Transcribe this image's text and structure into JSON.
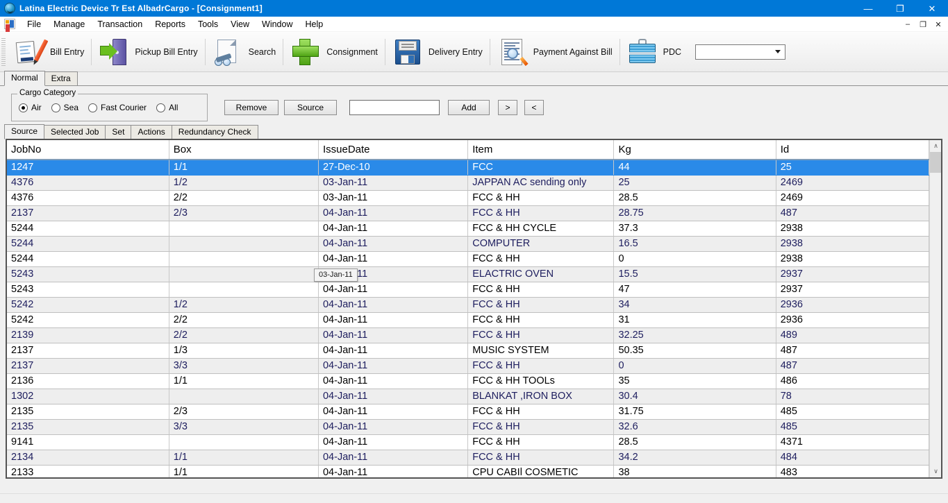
{
  "window": {
    "title": "Latina Electric Device Tr Est   AlbadrCargo - [Consignment1]",
    "app_icon": "app-globe-icon",
    "controls": {
      "minimize": "—",
      "maximize": "❐",
      "close": "✕"
    },
    "mdi_controls": {
      "minimize": "–",
      "restore": "❐",
      "close": "✕"
    },
    "accent": "#0078d7"
  },
  "menu": {
    "items": [
      "File",
      "Manage",
      "Transaction",
      "Reports",
      "Tools",
      "View",
      "Window",
      "Help"
    ]
  },
  "toolbar": {
    "items": [
      {
        "label": "Bill Entry",
        "icon": "bill-entry-icon"
      },
      {
        "label": "Pickup Bill Entry",
        "icon": "pickup-bill-entry-icon"
      },
      {
        "label": "Search",
        "icon": "search-icon"
      },
      {
        "label": "Consignment",
        "icon": "consignment-plus-icon"
      },
      {
        "label": "Delivery Entry",
        "icon": "delivery-entry-floppy-icon"
      },
      {
        "label": "Payment Against Bill",
        "icon": "payment-against-bill-icon"
      },
      {
        "label": "PDC",
        "icon": "pdc-briefcase-icon"
      }
    ],
    "pdc_combo": {
      "value": "",
      "caret": "chevron-down-icon"
    }
  },
  "tabs_top": {
    "items": [
      {
        "label": "Normal",
        "active": true
      },
      {
        "label": "Extra",
        "active": false
      }
    ]
  },
  "cargo_category": {
    "legend": "Cargo Category",
    "options": [
      {
        "label": "Air",
        "selected": true
      },
      {
        "label": "Sea",
        "selected": false
      },
      {
        "label": "Fast Courier",
        "selected": false
      },
      {
        "label": "All",
        "selected": false
      }
    ]
  },
  "actions": {
    "remove": "Remove",
    "source": "Source",
    "add": "Add",
    "next": ">",
    "prev": "<",
    "add_input": {
      "value": "",
      "placeholder": ""
    }
  },
  "tabs_sub": {
    "items": [
      {
        "label": "Source",
        "active": true
      },
      {
        "label": "Selected Job",
        "active": false
      },
      {
        "label": "Set",
        "active": false
      },
      {
        "label": "Actions",
        "active": false
      },
      {
        "label": "Redundancy Check",
        "active": false
      }
    ]
  },
  "tooltip": {
    "text": "03-Jan-11"
  },
  "grid": {
    "columns": [
      "JobNo",
      "Box",
      "IssueDate",
      "Item",
      "Kg",
      "Id"
    ],
    "selected_index": 0,
    "rows": [
      [
        "1247",
        "1/1",
        "27-Dec-10",
        "FCC",
        "44",
        "25"
      ],
      [
        "4376",
        "1/2",
        "03-Jan-11",
        "JAPPAN AC sending only",
        "25",
        "2469"
      ],
      [
        "4376",
        "2/2",
        "03-Jan-11",
        "FCC & HH",
        "28.5",
        "2469"
      ],
      [
        "2137",
        "2/3",
        "04-Jan-11",
        "FCC & HH",
        "28.75",
        "487"
      ],
      [
        "5244",
        "",
        "04-Jan-11",
        "FCC & HH CYCLE",
        "37.3",
        "2938"
      ],
      [
        "5244",
        "",
        "04-Jan-11",
        "COMPUTER",
        "16.5",
        "2938"
      ],
      [
        "5244",
        "",
        "04-Jan-11",
        "FCC & HH",
        "0",
        "2938"
      ],
      [
        "5243",
        "",
        "04-Jan-11",
        "ELACTRIC  OVEN",
        "15.5",
        "2937"
      ],
      [
        "5243",
        "",
        "04-Jan-11",
        "FCC & HH",
        "47",
        "2937"
      ],
      [
        "5242",
        "1/2",
        "04-Jan-11",
        "FCC & HH",
        "34",
        "2936"
      ],
      [
        "5242",
        "2/2",
        "04-Jan-11",
        "FCC & HH",
        "31",
        "2936"
      ],
      [
        "2139",
        "2/2",
        "04-Jan-11",
        "FCC & HH",
        "32.25",
        "489"
      ],
      [
        "2137",
        "1/3",
        "04-Jan-11",
        "MUSIC   SYSTEM",
        "50.35",
        "487"
      ],
      [
        "2137",
        "3/3",
        "04-Jan-11",
        "FCC & HH",
        "0",
        "487"
      ],
      [
        "2136",
        "1/1",
        "04-Jan-11",
        "FCC & HH TOOLs",
        "35",
        "486"
      ],
      [
        "1302",
        "",
        "04-Jan-11",
        "BLANKAT ,IRON BOX",
        "30.4",
        "78"
      ],
      [
        "2135",
        "2/3",
        "04-Jan-11",
        "FCC & HH",
        "31.75",
        "485"
      ],
      [
        "2135",
        "3/3",
        "04-Jan-11",
        "FCC & HH",
        "32.6",
        "485"
      ],
      [
        "9141",
        "",
        "04-Jan-11",
        "FCC & HH",
        "28.5",
        "4371"
      ],
      [
        "2134",
        "1/1",
        "04-Jan-11",
        "FCC & HH",
        "34.2",
        "484"
      ],
      [
        "2133",
        "1/1",
        "04-Jan-11",
        "CPU CABIl COSMETIC",
        "38",
        "483"
      ]
    ]
  },
  "scrollbar": {
    "up": "∧",
    "down": "∨"
  }
}
